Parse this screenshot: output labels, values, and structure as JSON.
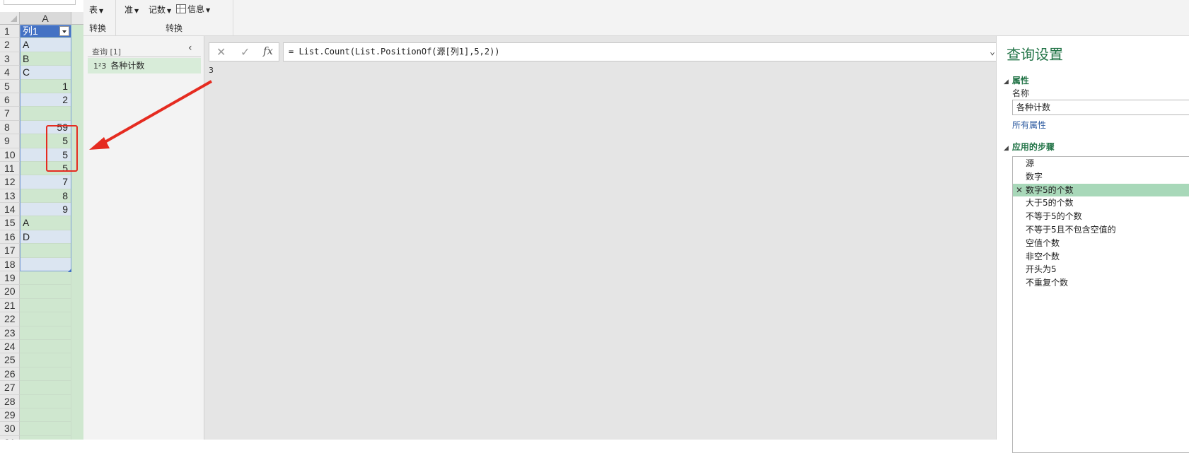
{
  "excel": {
    "column_header": "A",
    "rows": [
      {
        "n": "1",
        "v": "列1",
        "kind": "hdr"
      },
      {
        "n": "2",
        "v": "A",
        "kind": "text"
      },
      {
        "n": "3",
        "v": "B",
        "kind": "text"
      },
      {
        "n": "4",
        "v": "C",
        "kind": "text"
      },
      {
        "n": "5",
        "v": "1",
        "kind": "num"
      },
      {
        "n": "6",
        "v": "2",
        "kind": "num"
      },
      {
        "n": "7",
        "v": "",
        "kind": "num"
      },
      {
        "n": "8",
        "v": "59",
        "kind": "num"
      },
      {
        "n": "9",
        "v": "5",
        "kind": "num"
      },
      {
        "n": "10",
        "v": "5",
        "kind": "num"
      },
      {
        "n": "11",
        "v": "5",
        "kind": "num"
      },
      {
        "n": "12",
        "v": "7",
        "kind": "num"
      },
      {
        "n": "13",
        "v": "8",
        "kind": "num"
      },
      {
        "n": "14",
        "v": "9",
        "kind": "num"
      },
      {
        "n": "15",
        "v": "A",
        "kind": "text"
      },
      {
        "n": "16",
        "v": "D",
        "kind": "text"
      },
      {
        "n": "17",
        "v": "",
        "kind": "num"
      },
      {
        "n": "18",
        "v": "",
        "kind": "num"
      },
      {
        "n": "19",
        "v": "",
        "kind": "num"
      },
      {
        "n": "20",
        "v": "",
        "kind": "plain"
      },
      {
        "n": "21",
        "v": "",
        "kind": "plain"
      },
      {
        "n": "22",
        "v": "",
        "kind": "plain"
      },
      {
        "n": "23",
        "v": "",
        "kind": "plain"
      },
      {
        "n": "24",
        "v": "",
        "kind": "plain"
      },
      {
        "n": "25",
        "v": "",
        "kind": "plain"
      },
      {
        "n": "26",
        "v": "",
        "kind": "plain"
      },
      {
        "n": "27",
        "v": "",
        "kind": "plain"
      },
      {
        "n": "28",
        "v": "",
        "kind": "plain"
      },
      {
        "n": "29",
        "v": "",
        "kind": "plain"
      },
      {
        "n": "30",
        "v": "",
        "kind": "plain"
      },
      {
        "n": "31",
        "v": "",
        "kind": "plain"
      }
    ]
  },
  "ribbon": {
    "btn_table": "表",
    "btn_standard": "准",
    "btn_count": "记数",
    "btn_info": "信息",
    "group1_label": "转换",
    "group2_label": "转换"
  },
  "queries": {
    "title": "查询 [1]",
    "item_icon": "1²3",
    "item_label": "各种计数"
  },
  "formula_bar": {
    "cancel_icon": "✕",
    "confirm_icon": "✓",
    "fx_label": "fx",
    "formula": "= List.Count(List.PositionOf(源[列1],5,2))"
  },
  "result": "3",
  "settings": {
    "title": "查询设置",
    "properties_header": "属性",
    "name_label": "名称",
    "name_value": "各种计数",
    "all_properties_link": "所有属性",
    "steps_header": "应用的步骤",
    "steps": [
      "源",
      "数字",
      "数字5的个数",
      "大于5的个数",
      "不等于5的个数",
      "不等于5且不包含空值的",
      "空值个数",
      "非空个数",
      "开头为5",
      "不重复个数"
    ],
    "selected_step_index": 2
  },
  "colors": {
    "accent_green": "#217346",
    "annotation_red": "#e52b20",
    "table_header_blue": "#4472c4"
  }
}
